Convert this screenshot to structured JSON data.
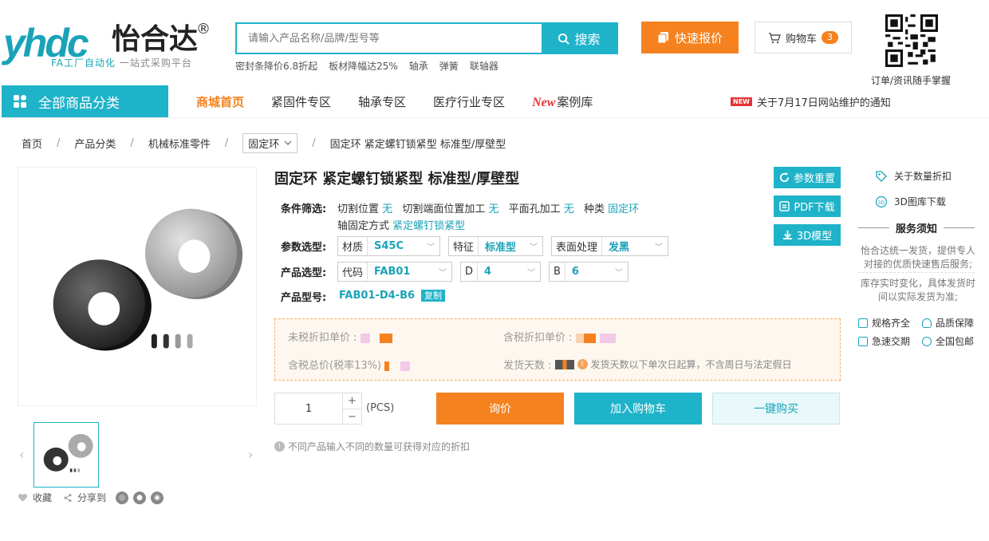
{
  "header": {
    "logo_mark": "yhdc",
    "logo_cn": "怡合达",
    "logo_reg": "®",
    "logo_sub_fa": "FA工厂自动化",
    "logo_sub_rest": " 一站式采购平台",
    "search_placeholder": "请输入产品名称/品牌/型号等",
    "search_label": "搜索",
    "hotwords": [
      "密封条降价6.8折起",
      "板材降幅达25%",
      "轴承",
      "弹簧",
      "联轴器"
    ],
    "quote_label": "快速报价",
    "cart_label": "购物车",
    "cart_count": "3",
    "qr_caption": "订单/资讯随手掌握"
  },
  "nav": {
    "all_categories": "全部商品分类",
    "items": [
      "商城首页",
      "紧固件专区",
      "轴承专区",
      "医疗行业专区"
    ],
    "new_tag": "New",
    "case_label": "案例库",
    "notice_badge": "NEW",
    "notice_text": "关于7月17日网站维护的通知"
  },
  "breadcrumb": {
    "items": [
      "首页",
      "产品分类",
      "机械标准零件"
    ],
    "select_value": "固定环",
    "current": "固定环 紧定螺钉锁紧型 标准型/厚壁型",
    "sep": "/"
  },
  "gallery": {
    "prev": "‹",
    "next": "›",
    "favorite": "收藏",
    "share": "分享到"
  },
  "product": {
    "title": "固定环 紧定螺钉锁紧型 标准型/厚壁型",
    "actions": {
      "reset": "参数重置",
      "pdf": "PDF下载",
      "model3d": "3D模型"
    },
    "filter_label": "条件筛选:",
    "filters": [
      {
        "k": "切割位置",
        "v": "无"
      },
      {
        "k": "切割端面位置加工",
        "v": "无"
      },
      {
        "k": "平面孔加工",
        "v": "无"
      },
      {
        "k": "种类",
        "v": "固定环"
      },
      {
        "k": "轴固定方式",
        "v": "紧定螺钉锁紧型"
      }
    ],
    "param_label": "参数选型:",
    "params": [
      {
        "k": "材质",
        "v": "S45C"
      },
      {
        "k": "特征",
        "v": "标准型"
      },
      {
        "k": "表面处理",
        "v": "发黑"
      }
    ],
    "select_label": "产品选型:",
    "selects": [
      {
        "k": "代码",
        "v": "FAB01"
      },
      {
        "k": "D",
        "v": "4"
      },
      {
        "k": "B",
        "v": "6"
      }
    ],
    "model_label": "产品型号:",
    "model_code": "FAB01-D4-B6",
    "copy_label": "复制"
  },
  "price": {
    "untaxed": "未税折扣单价 :",
    "taxed": "含税折扣单价 :",
    "total": "含税总价(税率13%)",
    "ship_days": "发货天数 :",
    "ship_note": "发货天数以下单次日起算，不含周日与法定假日"
  },
  "purchase": {
    "quantity": "1",
    "plus": "+",
    "minus": "−",
    "unit": "(PCS)",
    "inquiry": "询价",
    "add_cart": "加入购物车",
    "buy_now": "一键购买",
    "tip": "不同产品输入不同的数量可获得对应的折扣"
  },
  "sidebar": {
    "discount": "关于数量折扣",
    "cad": "3D图库下载",
    "service_title": "服务须知",
    "service_text1": "怡合达统一发货，提供专人对接的优质快速售后服务;",
    "service_text2": "库存实时变化，具体发货时间以实际发货为准;",
    "features": [
      "规格齐全",
      "品质保障",
      "急速交期",
      "全国包邮"
    ]
  },
  "colors": {
    "brand": "#1fb3c9",
    "accent": "#f5821f"
  }
}
